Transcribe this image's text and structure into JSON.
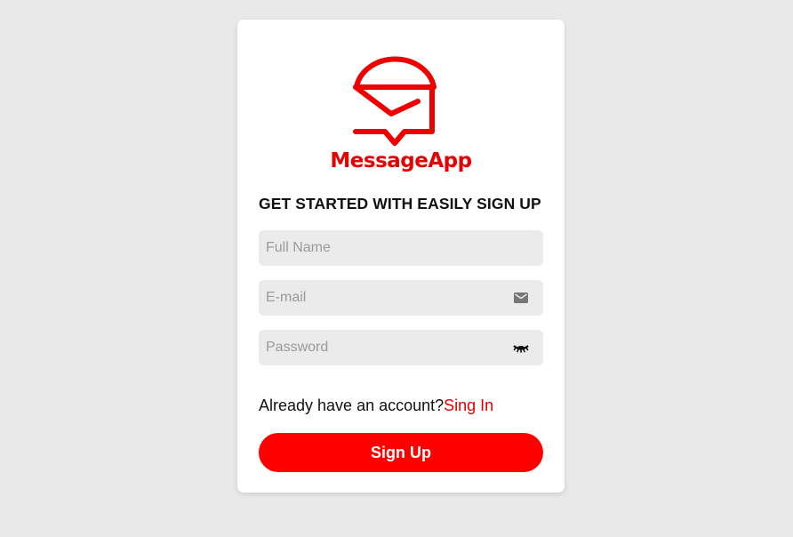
{
  "brand": {
    "name": "MessageApp",
    "color": "#e60000"
  },
  "form": {
    "heading": "GET STARTED WITH EASILY SIGN UP",
    "full_name": {
      "placeholder": "Full Name",
      "value": ""
    },
    "email": {
      "placeholder": "E-mail",
      "value": "",
      "icon": "mail-icon"
    },
    "password": {
      "placeholder": "Password",
      "value": "",
      "icon": "eye-closed-icon"
    },
    "already_text": "Already have an account?",
    "signin_link": "Sing In",
    "submit_label": "Sign Up"
  },
  "colors": {
    "accent": "#ff0000",
    "background": "#e9e9e9",
    "card": "#ffffff",
    "field": "#ebebeb"
  }
}
